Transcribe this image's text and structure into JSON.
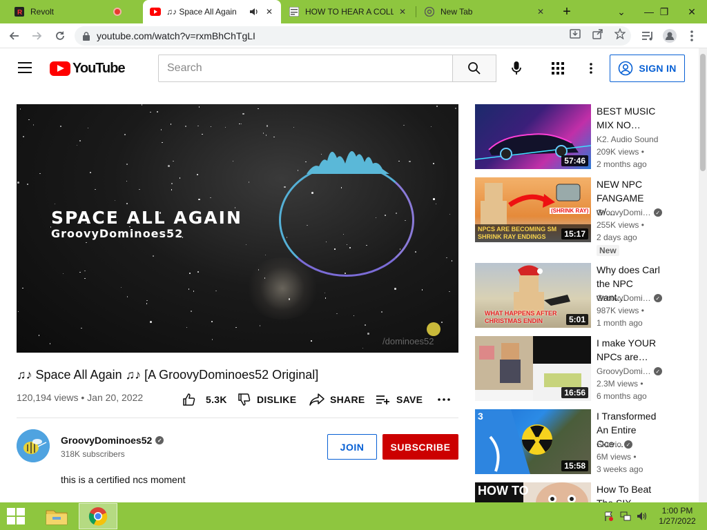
{
  "browser": {
    "tabs": [
      {
        "title": "Revolt",
        "favicon": "revolt-icon",
        "active": false
      },
      {
        "title": "♫♪ Space All Again",
        "favicon": "youtube-icon",
        "active": true
      },
      {
        "title": "HOW TO HEAR A COLLA",
        "favicon": "document-icon",
        "active": false
      },
      {
        "title": "New Tab",
        "favicon": "chrome-icon",
        "active": false
      }
    ],
    "new_tab_label": "+",
    "url": "youtube.com/watch?v=rxmBhChTgLI"
  },
  "youtube": {
    "logo_text": "YouTube",
    "search_placeholder": "Search",
    "signin_label": "SIGN IN"
  },
  "video": {
    "overlay_title": "SPACE ALL AGAIN",
    "overlay_channel": "GroovyDominoes52",
    "watermark": "/dominoes52",
    "title": "♫♪ Space All Again ♫♪ [A GroovyDominoes52 Original]",
    "meta": "120,194 views • Jan 20, 2022",
    "actions": {
      "like": "5.3K",
      "dislike": "DISLIKE",
      "share": "SHARE",
      "save": "SAVE"
    },
    "channel": {
      "name": "GroovyDominoes52",
      "subscribers": "318K subscribers"
    },
    "join_label": "JOIN",
    "subscribe_label": "SUBSCRIBE",
    "description": "this is a certified ncs moment"
  },
  "recommendations": [
    {
      "title": "BEST MUSIC MIX NO…",
      "channel": "K2. Audio Sound",
      "verified": false,
      "views": "209K views •",
      "age": "2 months ago",
      "duration": "57:46",
      "badge": ""
    },
    {
      "title": "NEW NPC FANGAME w/…",
      "channel": "GroovyDomi…",
      "verified": true,
      "views": "255K views •",
      "age": "2 days ago",
      "duration": "15:17",
      "badge": "New"
    },
    {
      "title": "Why does Carl the NPC want…",
      "channel": "GroovyDomi…",
      "verified": true,
      "views": "987K views •",
      "age": "1 month ago",
      "duration": "5:01",
      "badge": ""
    },
    {
      "title": "I make YOUR NPCs are…",
      "channel": "GroovyDomi…",
      "verified": true,
      "views": "2.3M views •",
      "age": "6 months ago",
      "duration": "16:56",
      "badge": ""
    },
    {
      "title": "I Transformed An Entire Oce…",
      "channel": "Skavio",
      "verified": true,
      "views": "6M views •",
      "age": "3 weeks ago",
      "duration": "15:58",
      "badge": ""
    },
    {
      "title": "How To Beat The SIX METE…",
      "channel": "",
      "verified": false,
      "views": "",
      "age": "",
      "duration": "",
      "badge": ""
    }
  ],
  "thumb_text": {
    "rec2_banner": "NPCS ARE BECOMING SM SHRINK RAY ENDINGS",
    "rec2_tag": "(SHRINK RAY)",
    "rec3_banner": "WHAT HAPPENS AFTER CHRISTMAS ENDIN",
    "rec5_badge": "3",
    "rec6_banner": "HOW TO"
  },
  "taskbar": {
    "time": "1:00 PM",
    "date": "1/27/2022"
  }
}
